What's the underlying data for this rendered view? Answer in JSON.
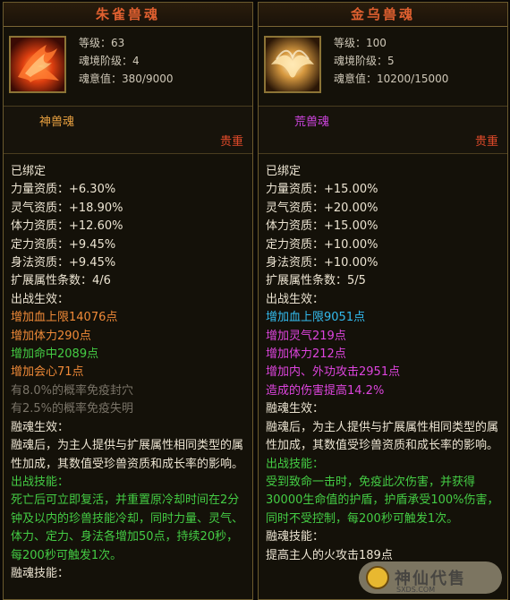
{
  "left": {
    "title": "朱雀兽魂",
    "level": "等级：63",
    "realm": "魂境阶级：4",
    "soul": "魂意值：380/9000",
    "type": "神兽魂",
    "type_color": "#e8a040",
    "rarity": "贵重",
    "lines": [
      {
        "text": "已绑定",
        "c": "w"
      },
      {
        "text": "力量资质：+6.30%",
        "c": "w"
      },
      {
        "text": "灵气资质：+18.90%",
        "c": "w"
      },
      {
        "text": "体力资质：+12.60%",
        "c": "w"
      },
      {
        "text": "定力资质：+9.45%",
        "c": "w"
      },
      {
        "text": "身法资质：+9.45%",
        "c": "w"
      },
      {
        "text": "扩展属性条数：4/6",
        "c": "w"
      },
      {
        "text": "出战生效：",
        "c": "w"
      },
      {
        "text": "增加血上限14076点",
        "c": "orange"
      },
      {
        "text": "增加体力290点",
        "c": "orange"
      },
      {
        "text": "增加命中2089点",
        "c": "green"
      },
      {
        "text": "增加会心71点",
        "c": "orange"
      },
      {
        "text": "有8.0%的概率免疫封穴",
        "c": "grey"
      },
      {
        "text": "有2.5%的概率免疫失明",
        "c": "grey"
      },
      {
        "text": "融魂生效：",
        "c": "w"
      },
      {
        "text": "融魂后，为主人提供与扩展属性相同类型的属性加成，其数值受珍兽资质和成长率的影响。",
        "c": "w",
        "para": true
      },
      {
        "text": "出战技能：",
        "c": "green"
      },
      {
        "text": "死亡后可立即复活，并重置原冷却时间在2分钟及以内的珍兽技能冷却，同时力量、灵气、体力、定力、身法各增加50点，持续20秒，每200秒可触发1次。",
        "c": "green",
        "para": true
      },
      {
        "text": "融魂技能：",
        "c": "w"
      }
    ]
  },
  "right": {
    "title": "金乌兽魂",
    "level": "等级：100",
    "realm": "魂境阶级：5",
    "soul": "魂意值：10200/15000",
    "type": "荒兽魂",
    "type_color": "#cc44dd",
    "rarity": "贵重",
    "lines": [
      {
        "text": "已绑定",
        "c": "w"
      },
      {
        "text": "力量资质：+15.00%",
        "c": "w"
      },
      {
        "text": "灵气资质：+20.00%",
        "c": "w"
      },
      {
        "text": "体力资质：+15.00%",
        "c": "w"
      },
      {
        "text": "定力资质：+10.00%",
        "c": "w"
      },
      {
        "text": "身法资质：+10.00%",
        "c": "w"
      },
      {
        "text": "扩展属性条数：5/5",
        "c": "w"
      },
      {
        "text": "出战生效：",
        "c": "w"
      },
      {
        "text": "增加血上限9051点",
        "c": "cyan"
      },
      {
        "text": "增加灵气219点",
        "c": "magenta"
      },
      {
        "text": "增加体力212点",
        "c": "magenta"
      },
      {
        "text": "增加内、外功攻击2951点",
        "c": "magenta"
      },
      {
        "text": "造成的伤害提高14.2%",
        "c": "magenta"
      },
      {
        "text": "融魂生效：",
        "c": "w"
      },
      {
        "text": "融魂后，为主人提供与扩展属性相同类型的属性加成，其数值受珍兽资质和成长率的影响。",
        "c": "w",
        "para": true
      },
      {
        "text": "出战技能：",
        "c": "green"
      },
      {
        "text": "受到致命一击时，免疫此次伤害，并获得30000生命值的护盾，护盾承受100%伤害，同时不受控制，每200秒可触发1次。",
        "c": "green",
        "para": true
      },
      {
        "text": "融魂技能：",
        "c": "w"
      },
      {
        "text": "提高主人的火攻击189点",
        "c": "w"
      }
    ]
  },
  "watermark": {
    "text": "神仙代售",
    "url": "SXDS.COM"
  }
}
